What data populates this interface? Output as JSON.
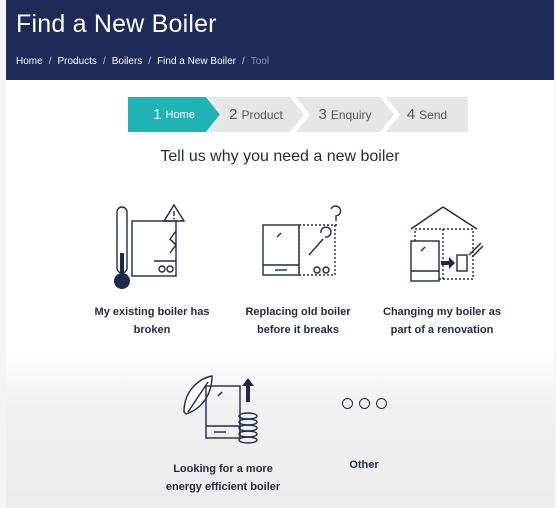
{
  "header": {
    "title": "Find a New Boiler",
    "breadcrumbs": [
      "Home",
      "Products",
      "Boilers",
      "Find a New Boiler"
    ],
    "current_crumb": "Tool",
    "separator": "/"
  },
  "stepper": {
    "steps": [
      {
        "num": "1",
        "label": "Home"
      },
      {
        "num": "2",
        "label": "Product"
      },
      {
        "num": "3",
        "label": "Enquiry"
      },
      {
        "num": "4",
        "label": "Send"
      }
    ],
    "active_step": 1
  },
  "main": {
    "question": "Tell us why you need a new boiler",
    "options": [
      {
        "label_line1": "My existing boiler has",
        "label_line2": "broken",
        "icon": "broken-boiler-icon"
      },
      {
        "label_line1": "Replacing old boiler",
        "label_line2": "before it breaks",
        "icon": "replace-boiler-icon"
      },
      {
        "label_line1": "Changing my boiler as",
        "label_line2": "part of a renovation",
        "icon": "renovation-icon"
      },
      {
        "label_line1": "Looking for a more",
        "label_line2": "energy efficient boiler",
        "icon": "energy-efficient-icon"
      },
      {
        "label_line1": "Other",
        "label_line2": "",
        "icon": "more-dots-icon"
      }
    ]
  },
  "colors": {
    "header_bg": "#1e2a57",
    "accent": "#1fb3b3",
    "text": "#1f2a4a"
  }
}
